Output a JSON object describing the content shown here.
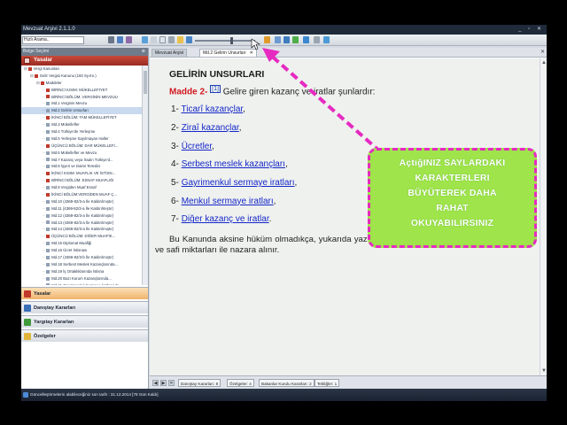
{
  "window": {
    "title": "Mevzuat Arşivi 2.1.1.0",
    "controls": "_ ▫ ✕"
  },
  "toolbar": {
    "search_placeholder": "Hızlı Arama.."
  },
  "left_panel": {
    "header": "Belge Seçimi",
    "pin": "⊕",
    "section_title": "Yasalar",
    "tree": [
      {
        "label": "Vergi Kanunları",
        "depth": 0,
        "color": "#c0392b"
      },
      {
        "label": "Gelir Vergisi Kanunu  (193 Sy.Kn.)",
        "depth": 1,
        "color": "#c0392b"
      },
      {
        "label": "Maddeler",
        "depth": 2,
        "color": "#c0392b"
      },
      {
        "label": "BİRİNCİ KISIM: MÜKELLEFİYET",
        "depth": 3,
        "color": "#c0392b"
      },
      {
        "label": "BİRİNCİ BÖLÜM: VERGİNİN MEVZUU",
        "depth": 3,
        "color": "#c0392b"
      },
      {
        "label": "Md.1 Verginin Mevzu",
        "depth": 3,
        "color": "#8fa0b5"
      },
      {
        "label": "Md.2 Gelirin Unsurları",
        "depth": 3,
        "color": "#8fa0b5",
        "selected": true
      },
      {
        "label": "İKİNCİ BÖLÜM: TAM MÜKELLEFİYET",
        "depth": 3,
        "color": "#c0392b"
      },
      {
        "label": "Md.3 Mükellefler",
        "depth": 3,
        "color": "#8fa0b5"
      },
      {
        "label": "Md.4 Türkiye'de Yerleşme",
        "depth": 3,
        "color": "#8fa0b5"
      },
      {
        "label": "Md.5 Yerleşme Sayılmayan Haller",
        "depth": 3,
        "color": "#8fa0b5"
      },
      {
        "label": "ÜÇÜNCÜ BÖLÜM: DAR MÜKELLEFİ...",
        "depth": 3,
        "color": "#c0392b"
      },
      {
        "label": "Md.6 Mükellefler ve Mevzu",
        "depth": 3,
        "color": "#8fa0b5"
      },
      {
        "label": "Md.7 Kazanç veya İradın Türkiye'd...",
        "depth": 3,
        "color": "#8fa0b5"
      },
      {
        "label": "Md.8 İşyeri ve Daimi Temsilci",
        "depth": 3,
        "color": "#8fa0b5"
      },
      {
        "label": "İKİNCİ KISIM: MUAFLIK VE İSTİSN...",
        "depth": 3,
        "color": "#c0392b"
      },
      {
        "label": "BİRİNCİ BÖLÜM: ESNAF MUAFLIĞI",
        "depth": 3,
        "color": "#c0392b"
      },
      {
        "label": "Md.9 Vergiden Muaf Esnaf",
        "depth": 3,
        "color": "#8fa0b5"
      },
      {
        "label": "İKİNCİ BÖLÜM:VERGİDEN MUAF Ç...",
        "depth": 3,
        "color": "#c0392b"
      },
      {
        "label": "Md.10 (4369-82/3-a İle Kaldırılmıştır)",
        "depth": 3,
        "color": "#8fa0b5"
      },
      {
        "label": "Md.11 (4369-82/3-a İle Kaldırılmıştır)",
        "depth": 3,
        "color": "#8fa0b5"
      },
      {
        "label": "Md.12 (4369-82/3-a İle Kaldırılmıştır)",
        "depth": 3,
        "color": "#8fa0b5"
      },
      {
        "label": "Md.13 (4369-82/3-a İle Kaldırılmıştır)",
        "depth": 3,
        "color": "#8fa0b5"
      },
      {
        "label": "Md.14 (4369-82/3-a İle Kaldırılmıştır)",
        "depth": 3,
        "color": "#8fa0b5"
      },
      {
        "label": "ÜÇÜNCÜ BÖLÜM: DİĞER MUAFİK...",
        "depth": 3,
        "color": "#c0392b"
      },
      {
        "label": "Md.15 Diplomat Muafiği",
        "depth": 3,
        "color": "#8fa0b5"
      },
      {
        "label": "Md.16 Ücret İstisnası",
        "depth": 3,
        "color": "#8fa0b5"
      },
      {
        "label": "Md.17 (4369-82/3-b İle Kaldırılmıştır)",
        "depth": 3,
        "color": "#8fa0b5"
      },
      {
        "label": "Md.18 Serbest Meslek Kazançlarında...",
        "depth": 3,
        "color": "#8fa0b5"
      },
      {
        "label": "Md.19 İş Ortaklıklarında İstisna",
        "depth": 3,
        "color": "#8fa0b5"
      },
      {
        "label": "Md.20 Bazı Kurum Kazançlarında...",
        "depth": 3,
        "color": "#8fa0b5"
      },
      {
        "label": "Md.21 Gayrimenkul Sermaye İratlarında...",
        "depth": 3,
        "color": "#8fa0b5"
      }
    ],
    "nav": [
      {
        "label": "Yasalar",
        "color": "#c0392b",
        "active": true
      },
      {
        "label": "Danıştay Kararları",
        "color": "#3a6fb5",
        "active": false
      },
      {
        "label": "Yargıtay Kararları",
        "color": "#3f9a3a",
        "active": false
      },
      {
        "label": "Özelgeler",
        "color": "#e0b43a",
        "active": false
      }
    ]
  },
  "tabs": [
    {
      "label": "Mevzuat Arşivi",
      "active": false
    },
    {
      "label": "Md.2 Gelirin Unsurları",
      "active": true,
      "close": "✕"
    }
  ],
  "tabs_close": "✕",
  "document": {
    "title": "GELİRİN UNSURLARI",
    "madde_label": "Madde 2-",
    "footnote": "[1]",
    "madde_text": "Gelire giren kazanç ve iratlar şunlardır:",
    "items": [
      {
        "num": "1-",
        "link": "Ticarî kazançlar",
        "suffix": ","
      },
      {
        "num": "2-",
        "link": "Ziraî kazançlar",
        "suffix": ","
      },
      {
        "num": "3-",
        "link": "Ücretler",
        "suffix": ","
      },
      {
        "num": "4-",
        "link": "Serbest meslek kazançları",
        "suffix": ","
      },
      {
        "num": "5-",
        "link": "Gayrimenkul sermaye iratları",
        "suffix": ","
      },
      {
        "num": "6-",
        "link": "Menkul sermaye iratları",
        "suffix": ","
      },
      {
        "num": "7-",
        "link": "Diğer kazanç ve iratlar",
        "suffix": "."
      }
    ],
    "paragraph": "Bu Kanunda aksine hüküm olmadıkça, yukarıda yazılı kazanç ve iratlar gelirin tespitinde gerçek ve safi miktarları ile nazara alınır."
  },
  "bottom_tabs": [
    "Danıştay Kararları: 8",
    "Özelgeler: 4",
    "Bakanlar Kurulu Kararları: 2",
    "Tebliğler: 1"
  ],
  "status": {
    "text": "Güncelleştirmelerin alabileceğiniz son tarih : 31.12.2014 [78 Gün Kaldı]"
  },
  "annotation": {
    "lines": [
      "AçtığINIZ SAYLARDAKI",
      "KARAKTERLERI",
      "BÜYÜTEREK DAHA",
      "RAHAT",
      "OKUYABILIRSINIZ"
    ],
    "border_color": "#e62ac0",
    "fill_color": "#9fe44a"
  }
}
